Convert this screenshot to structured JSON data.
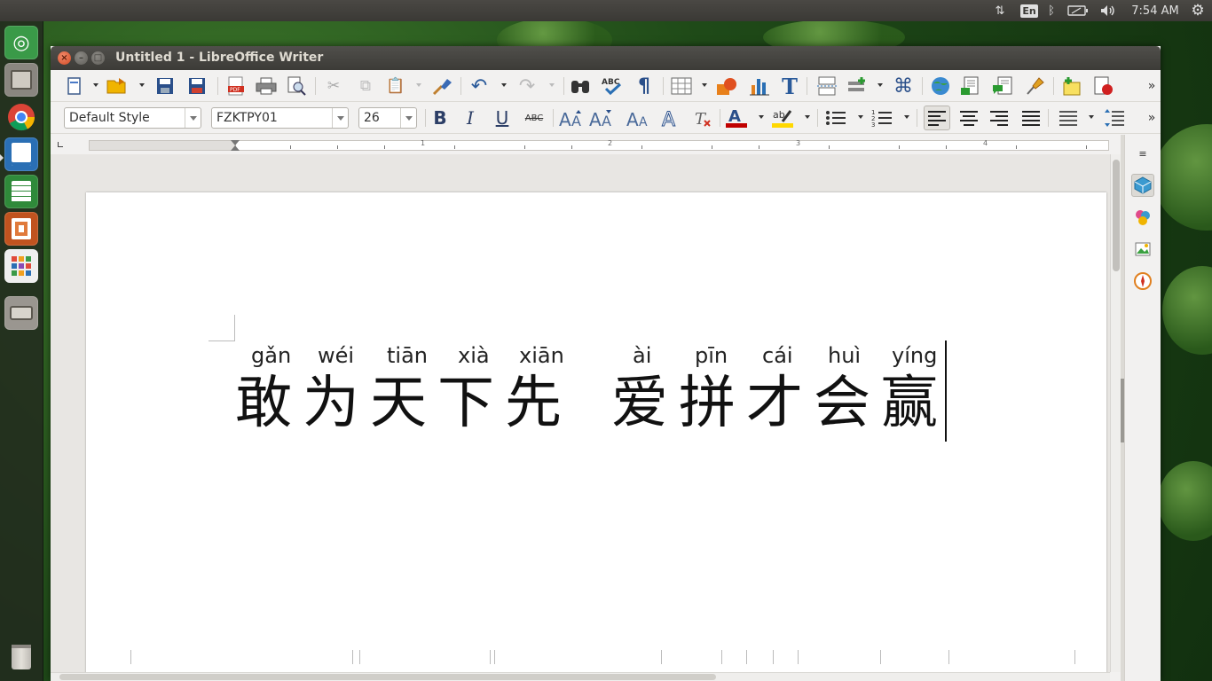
{
  "panel": {
    "keyboard_lang": "En",
    "clock": "7:54 AM"
  },
  "launcher": {
    "items": [
      {
        "name": "dash-home",
        "icon": "ubuntu-icon"
      },
      {
        "name": "files",
        "icon": "file-cabinet-icon"
      },
      {
        "name": "chrome",
        "icon": "chrome-icon"
      },
      {
        "name": "writer",
        "icon": "writer-icon"
      },
      {
        "name": "calc",
        "icon": "calc-icon"
      },
      {
        "name": "impress",
        "icon": "impress-icon"
      },
      {
        "name": "software-center",
        "icon": "apps-grid-icon"
      },
      {
        "name": "drive",
        "icon": "drive-icon"
      },
      {
        "name": "trash",
        "icon": "trash-icon"
      }
    ]
  },
  "window": {
    "title": "Untitled 1 - LibreOffice Writer"
  },
  "formatting": {
    "paragraph_style": "Default Style",
    "font_name": "FZKTPY01",
    "font_size": "26",
    "strike_label": "ABC",
    "bold": "B",
    "italic": "I",
    "underline": "U"
  },
  "ruler": {
    "numbers": [
      "1",
      "2",
      "3",
      "4"
    ]
  },
  "document": {
    "pinyin": [
      "gǎn",
      "wéi",
      "tiān",
      "xià",
      "xiān",
      "ài",
      "pīn",
      "cái",
      "huì",
      "yíng"
    ],
    "hanzi_1": "敢为天下先",
    "hanzi_2": "爱拼才会赢"
  },
  "colors": {
    "accent": "#3c5a8a",
    "font_color": "#c00000",
    "highlight": "#ffd800"
  }
}
